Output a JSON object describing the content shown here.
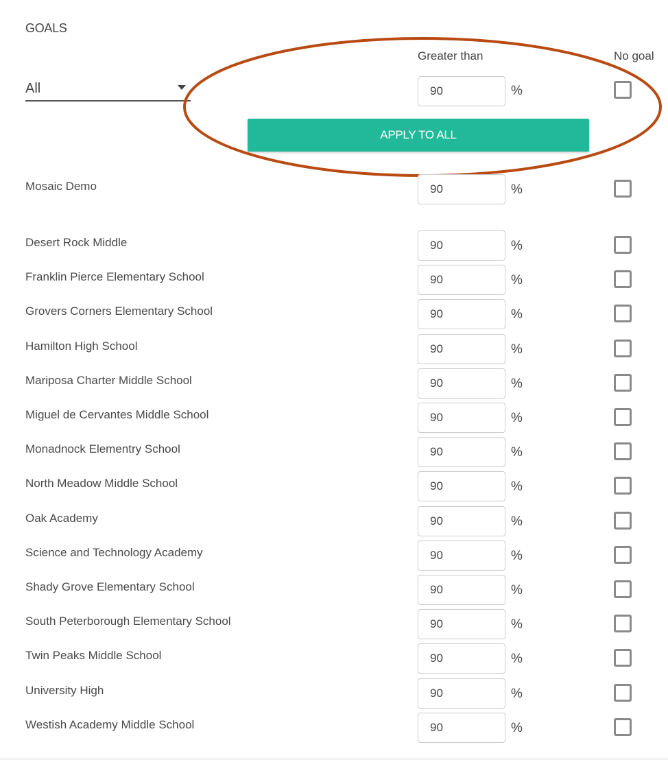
{
  "title": "GOALS",
  "columns": {
    "greater_than": "Greater than",
    "no_goal": "No goal"
  },
  "filter": {
    "selected": "All"
  },
  "apply_all": {
    "value": "90",
    "unit": "%",
    "no_goal": false,
    "button_label": "APPLY TO ALL"
  },
  "annotation_color": "#b84a12",
  "accent_color": "#22b89a",
  "rows": [
    {
      "name": "Mosaic Demo",
      "value": "90",
      "unit": "%",
      "no_goal": false
    },
    {
      "name": "Desert Rock Middle",
      "value": "90",
      "unit": "%",
      "no_goal": false
    },
    {
      "name": "Franklin Pierce Elementary School",
      "value": "90",
      "unit": "%",
      "no_goal": false
    },
    {
      "name": "Grovers Corners Elementary School",
      "value": "90",
      "unit": "%",
      "no_goal": false
    },
    {
      "name": "Hamilton High School",
      "value": "90",
      "unit": "%",
      "no_goal": false
    },
    {
      "name": "Mariposa Charter Middle School",
      "value": "90",
      "unit": "%",
      "no_goal": false
    },
    {
      "name": "Miguel de Cervantes Middle School",
      "value": "90",
      "unit": "%",
      "no_goal": false
    },
    {
      "name": "Monadnock Elementry School",
      "value": "90",
      "unit": "%",
      "no_goal": false
    },
    {
      "name": "North Meadow Middle School",
      "value": "90",
      "unit": "%",
      "no_goal": false
    },
    {
      "name": "Oak Academy",
      "value": "90",
      "unit": "%",
      "no_goal": false
    },
    {
      "name": "Science and Technology Academy",
      "value": "90",
      "unit": "%",
      "no_goal": false
    },
    {
      "name": "Shady Grove Elementary School",
      "value": "90",
      "unit": "%",
      "no_goal": false
    },
    {
      "name": "South Peterborough Elementary School",
      "value": "90",
      "unit": "%",
      "no_goal": false
    },
    {
      "name": "Twin Peaks Middle School",
      "value": "90",
      "unit": "%",
      "no_goal": false
    },
    {
      "name": "University High",
      "value": "90",
      "unit": "%",
      "no_goal": false
    },
    {
      "name": "Westish Academy Middle School",
      "value": "90",
      "unit": "%",
      "no_goal": false
    }
  ]
}
